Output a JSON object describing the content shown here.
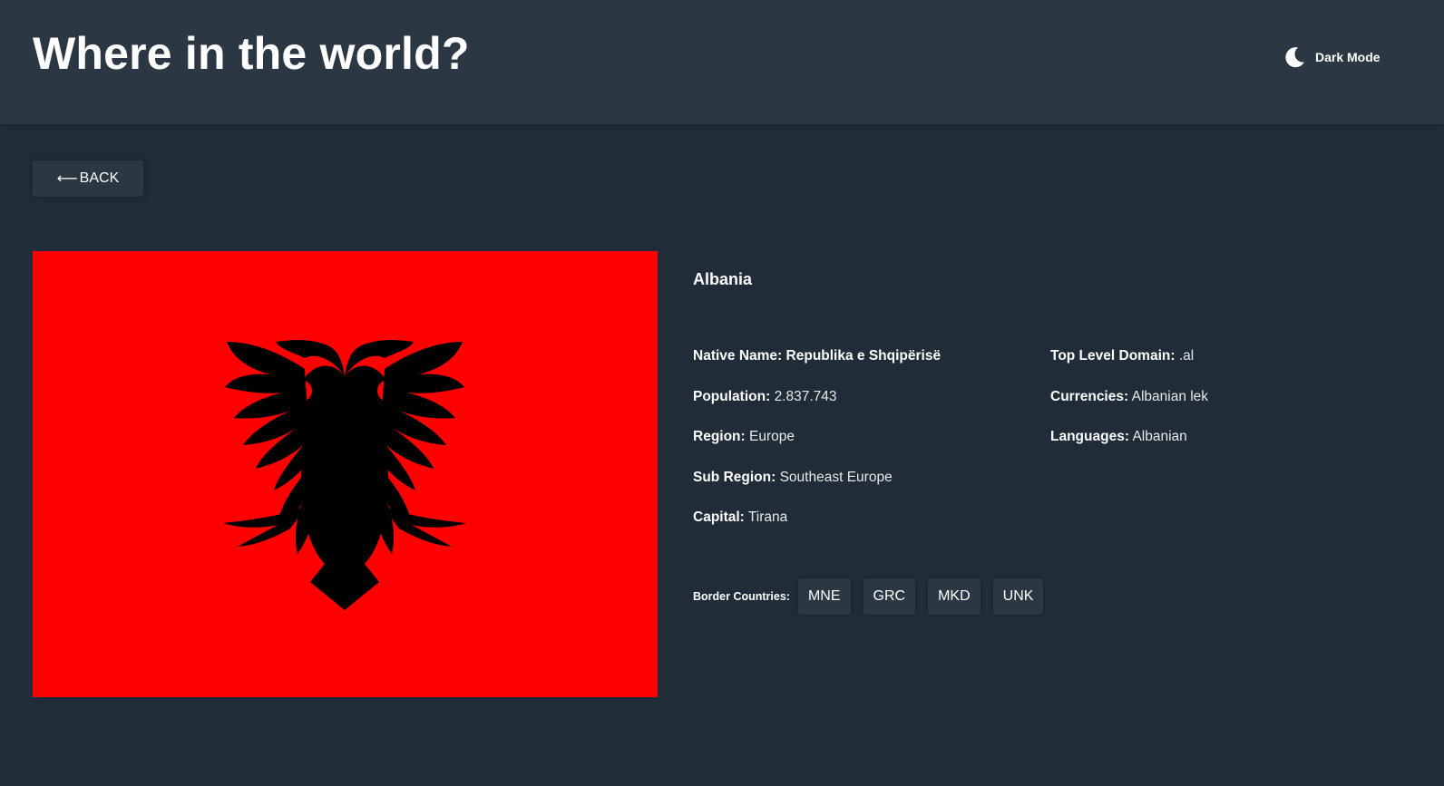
{
  "header": {
    "title": "Where in the world?",
    "theme_toggle": {
      "icon": "moon-icon",
      "label": "Dark Mode"
    }
  },
  "back_button": {
    "arrow": "⟵",
    "label": "BACK"
  },
  "flag": {
    "icon": "albania-flag",
    "background": "#ff0000",
    "emblem": "#000000"
  },
  "country": {
    "name": "Albania",
    "native_name": {
      "label": "Native Name:",
      "value": "Republika e Shqipërisë"
    },
    "population": {
      "label": "Population:",
      "value": "2.837.743"
    },
    "region": {
      "label": "Region:",
      "value": "Europe"
    },
    "sub_region": {
      "label": "Sub Region:",
      "value": "Southeast Europe"
    },
    "capital": {
      "label": "Capital:",
      "value": "Tirana"
    },
    "top_level_domain": {
      "label": "Top Level Domain:",
      "value": ".al"
    },
    "currencies": {
      "label": "Currencies:",
      "value": "Albanian lek"
    },
    "languages": {
      "label": "Languages:",
      "value": "Albanian"
    }
  },
  "borders": {
    "label": "Border Countries:",
    "countries": [
      "MNE",
      "GRC",
      "MKD",
      "UNK"
    ]
  },
  "colors": {
    "background": "#202c37",
    "elements": "#2b3844",
    "text": "#ffffff"
  }
}
